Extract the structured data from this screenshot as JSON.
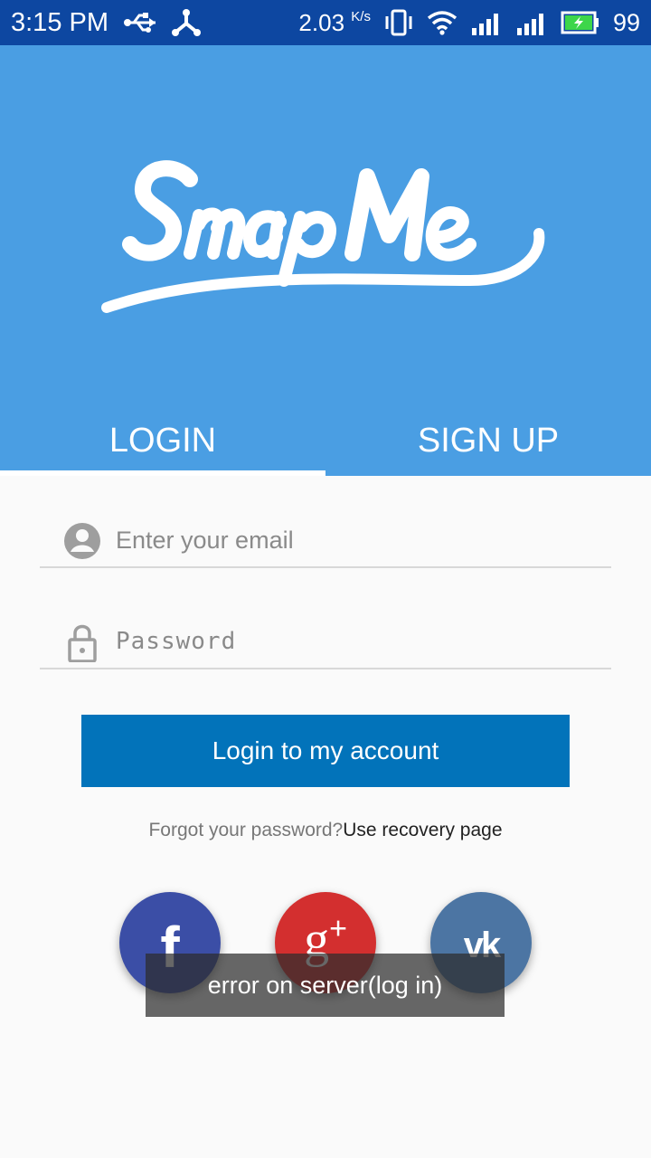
{
  "status_bar": {
    "time": "3:15 PM",
    "speed": "2.03",
    "speed_unit": "K/s",
    "battery_percent": "99",
    "icons": [
      "usb-icon",
      "share-icon",
      "vibrate-icon",
      "wifi-icon",
      "signal-icon",
      "signal-icon",
      "battery-icon"
    ]
  },
  "brand": {
    "logo_text": "SmapMe",
    "header_color": "#4a9ee3"
  },
  "tabs": [
    {
      "label": "LOGIN",
      "active": true
    },
    {
      "label": "SIGN UP",
      "active": false
    }
  ],
  "form": {
    "email_placeholder": "Enter your email",
    "email_value": "",
    "password_placeholder": "Password",
    "password_value": "",
    "login_label": "Login to my account",
    "login_color": "#0273ba"
  },
  "recovery": {
    "text": "Forgot your password?",
    "link": "Use recovery page"
  },
  "social": {
    "facebook": "f",
    "google": "g",
    "google_plus": "+",
    "vk": "vk"
  },
  "toast": {
    "message": "error on server(log in)"
  }
}
